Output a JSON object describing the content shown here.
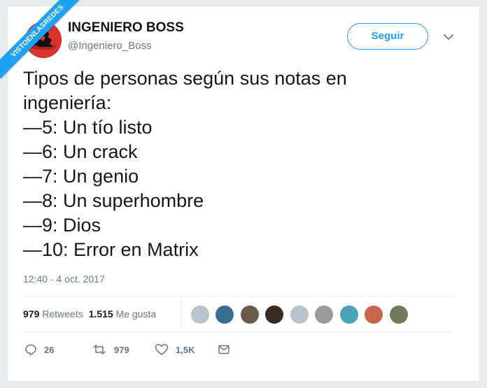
{
  "watermark": "VISTOENLASREDES",
  "author": {
    "name": "INGENIERO BOSS",
    "handle": "@Ingeniero_Boss",
    "avatar_color": "#d9332f"
  },
  "follow_label": "Seguir",
  "tweet": {
    "lines": [
      "Tipos de personas según sus notas en",
      "ingeniería:",
      "—5: Un tío listo",
      "—6: Un crack",
      "—7: Un genio",
      "—8: Un superhombre",
      "—9: Dios",
      "—10: Error en Matrix"
    ],
    "timestamp": "12:40 - 4 oct. 2017"
  },
  "stats": {
    "retweets_count": "979",
    "retweets_label": "Retweets",
    "likes_count": "1.515",
    "likes_label": "Me gusta"
  },
  "actions": {
    "replies": "26",
    "retweets": "979",
    "likes": "1,5K"
  },
  "colors": {
    "accent": "#1da1f2",
    "muted": "#657786",
    "text": "#14171a"
  }
}
